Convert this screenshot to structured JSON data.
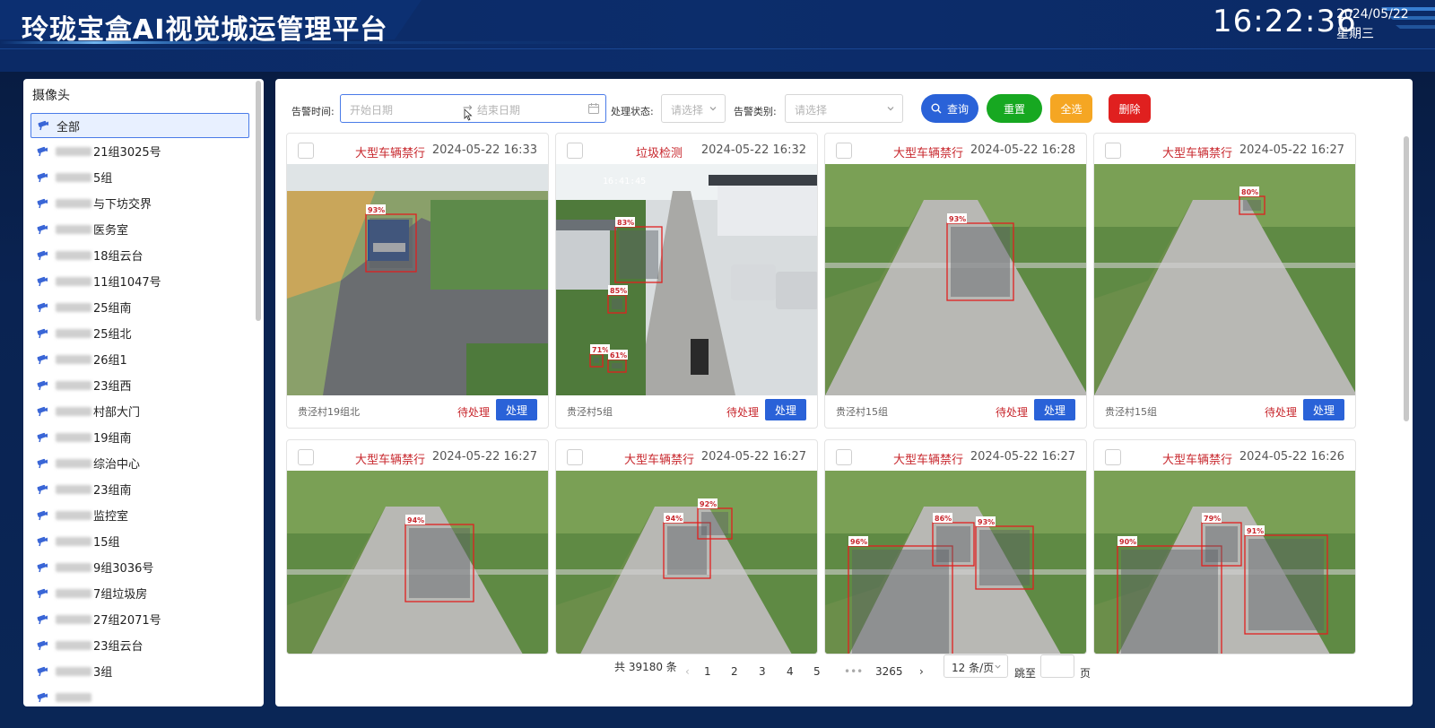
{
  "header": {
    "title": "玲珑宝盒AI视觉城运管理平台",
    "time": "16:22:36",
    "date": "2024/05/22",
    "weekday": "星期三"
  },
  "sidebar": {
    "title": "摄像头",
    "items": [
      {
        "label": "全部",
        "active": true
      },
      {
        "label": "21组3025号"
      },
      {
        "label": "5组"
      },
      {
        "label": "与下坊交界"
      },
      {
        "label": "医务室"
      },
      {
        "label": "18组云台"
      },
      {
        "label": "11组1047号"
      },
      {
        "label": "25组南"
      },
      {
        "label": "25组北"
      },
      {
        "label": "26组1"
      },
      {
        "label": "23组西"
      },
      {
        "label": "村部大门"
      },
      {
        "label": "19组南"
      },
      {
        "label": "综治中心"
      },
      {
        "label": "23组南"
      },
      {
        "label": "监控室"
      },
      {
        "label": "15组"
      },
      {
        "label": "9组3036号"
      },
      {
        "label": "7组垃圾房"
      },
      {
        "label": "27组2071号"
      },
      {
        "label": "23组云台"
      },
      {
        "label": "3组"
      },
      {
        "label": ""
      }
    ]
  },
  "filters": {
    "alarm_time_label": "告警时间:",
    "start_placeholder": "开始日期",
    "range_separator": "→",
    "end_placeholder": "结束日期",
    "status_label": "处理状态:",
    "status_placeholder": "请选择",
    "type_label": "告警类别:",
    "type_placeholder": "请选择",
    "query_label": "查询",
    "reset_label": "重置",
    "select_all_label": "全选",
    "delete_label": "删除"
  },
  "colors": {
    "query": "#2a62d8",
    "reset": "#17a821",
    "select_all": "#f5a623",
    "delete": "#e0201f",
    "alarm_text": "#c8282e"
  },
  "cards": [
    {
      "type": "大型车辆禁行",
      "time": "2024-05-22 16:33",
      "location": "贵泾村19组北",
      "status": "待处理",
      "action": "处理",
      "scene": "road",
      "boxes": [
        {
          "label": "93%"
        }
      ]
    },
    {
      "type": "垃圾检测",
      "time": "2024-05-22 16:32",
      "location": "贵泾村5组",
      "status": "待处理",
      "action": "处理",
      "scene": "village",
      "stamp": "16:41:45",
      "boxes": [
        {
          "label": "83%"
        },
        {
          "label": "85%"
        },
        {
          "label": "71%"
        },
        {
          "label": "61%"
        }
      ]
    },
    {
      "type": "大型车辆禁行",
      "time": "2024-05-22 16:28",
      "location": "贵泾村15组",
      "status": "待处理",
      "action": "处理",
      "scene": "lane",
      "boxes": [
        {
          "label": "93%"
        }
      ]
    },
    {
      "type": "大型车辆禁行",
      "time": "2024-05-22 16:27",
      "location": "贵泾村15组",
      "status": "待处理",
      "action": "处理",
      "scene": "lane",
      "boxes": [
        {
          "label": "80%"
        }
      ]
    },
    {
      "type": "大型车辆禁行",
      "time": "2024-05-22 16:27",
      "location": "",
      "status": "",
      "action": "",
      "scene": "lane",
      "boxes": [
        {
          "label": "94%"
        }
      ]
    },
    {
      "type": "大型车辆禁行",
      "time": "2024-05-22 16:27",
      "location": "",
      "status": "",
      "action": "",
      "scene": "lane",
      "boxes": [
        {
          "label": "94%"
        },
        {
          "label": "92%"
        }
      ]
    },
    {
      "type": "大型车辆禁行",
      "time": "2024-05-22 16:27",
      "location": "",
      "status": "",
      "action": "",
      "scene": "lane",
      "boxes": [
        {
          "label": "96%"
        },
        {
          "label": "86%"
        },
        {
          "label": "93%"
        }
      ]
    },
    {
      "type": "大型车辆禁行",
      "time": "2024-05-22 16:26",
      "location": "",
      "status": "",
      "action": "",
      "scene": "lane",
      "boxes": [
        {
          "label": "90%"
        },
        {
          "label": "79%"
        },
        {
          "label": "91%"
        }
      ]
    }
  ],
  "pagination": {
    "total_label": "共 39180 条",
    "pages": [
      "1",
      "2",
      "3",
      "4",
      "5"
    ],
    "ellipsis": "•••",
    "last_page": "3265",
    "page_size_label": "12 条/页",
    "jump_label": "跳至",
    "page_suffix": "页"
  }
}
